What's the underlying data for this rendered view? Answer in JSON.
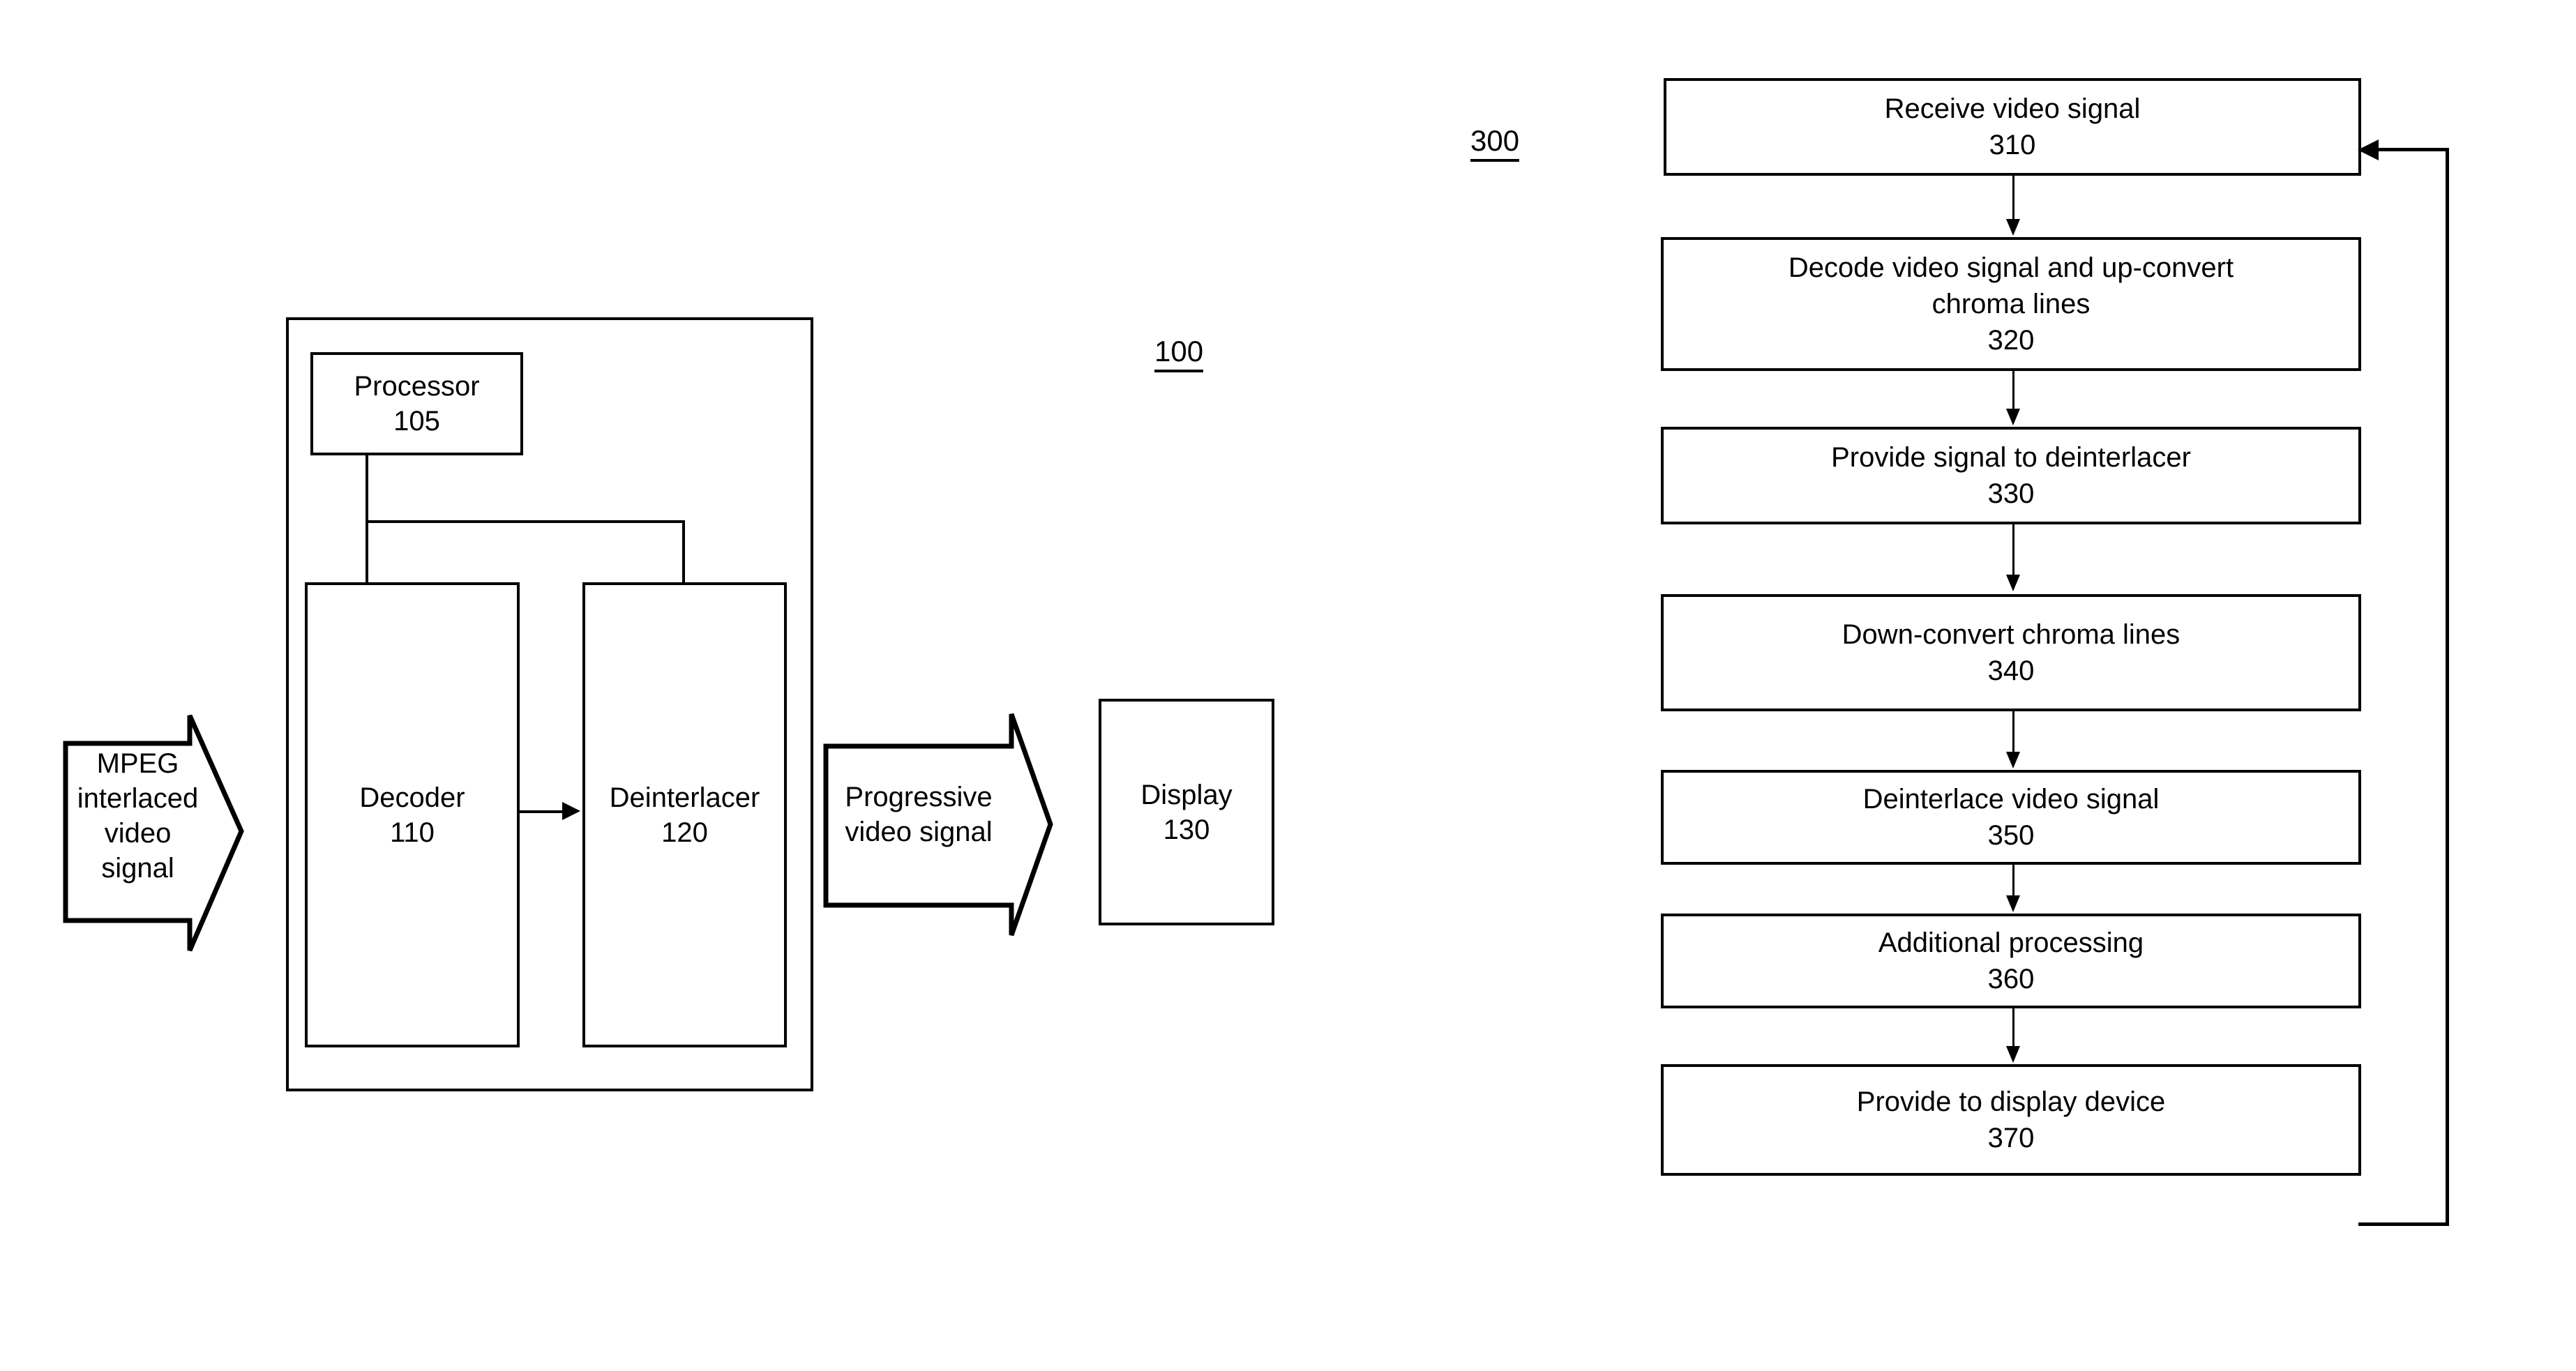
{
  "figure1": {
    "reference_number": "100",
    "outer_system_label": "",
    "blocks": [
      {
        "name": "processor",
        "title": "Processor",
        "number": "105"
      },
      {
        "name": "decoder",
        "title": "Decoder",
        "number": "110"
      },
      {
        "name": "deinterlacer",
        "title": "Deinterlacer",
        "number": "120"
      },
      {
        "name": "display",
        "title": "Display",
        "number": "130"
      }
    ],
    "input_arrow": {
      "lines": [
        "MPEG",
        "interlaced",
        "video",
        "signal"
      ],
      "text": "MPEG interlaced video signal"
    },
    "output_arrow": {
      "lines": [
        "Progressive",
        "video signal"
      ],
      "text": "Progressive video signal"
    }
  },
  "figure3": {
    "reference_number": "300",
    "steps": [
      {
        "lines": [
          "Receive video signal"
        ],
        "number": "310"
      },
      {
        "lines": [
          "Decode video signal and up-convert",
          "chroma lines"
        ],
        "number": "320"
      },
      {
        "lines": [
          "Provide signal to deinterlacer"
        ],
        "number": "330"
      },
      {
        "lines": [
          "Down-convert chroma lines"
        ],
        "number": "340"
      },
      {
        "lines": [
          "Deinterlace video signal"
        ],
        "number": "350"
      },
      {
        "lines": [
          "Additional processing"
        ],
        "number": "360"
      },
      {
        "lines": [
          "Provide to display device"
        ],
        "number": "370"
      }
    ],
    "feedback_loop": {
      "from_step": "370",
      "to_step": "310"
    }
  },
  "colors": {
    "ink": "#000000",
    "paper": "#ffffff"
  }
}
